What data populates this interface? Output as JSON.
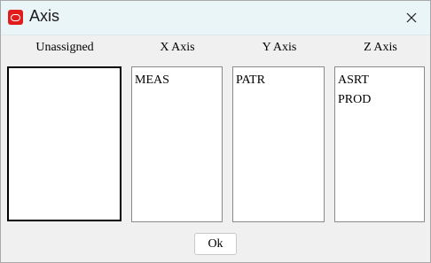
{
  "window": {
    "title": "Axis",
    "app_icon": "oracle-logo-icon",
    "close_icon": "close-icon"
  },
  "columns": [
    {
      "label": "Unassigned",
      "items": []
    },
    {
      "label": "X Axis",
      "items": [
        "MEAS"
      ]
    },
    {
      "label": "Y Axis",
      "items": [
        "PATR"
      ]
    },
    {
      "label": "Z Axis",
      "items": [
        "ASRT",
        "PROD"
      ]
    }
  ],
  "footer": {
    "ok_label": "Ok"
  },
  "colors": {
    "titlebar_bg": "#eaf5f8",
    "app_icon": "#e01c1c",
    "dialog_bg": "#f0f0f0"
  }
}
